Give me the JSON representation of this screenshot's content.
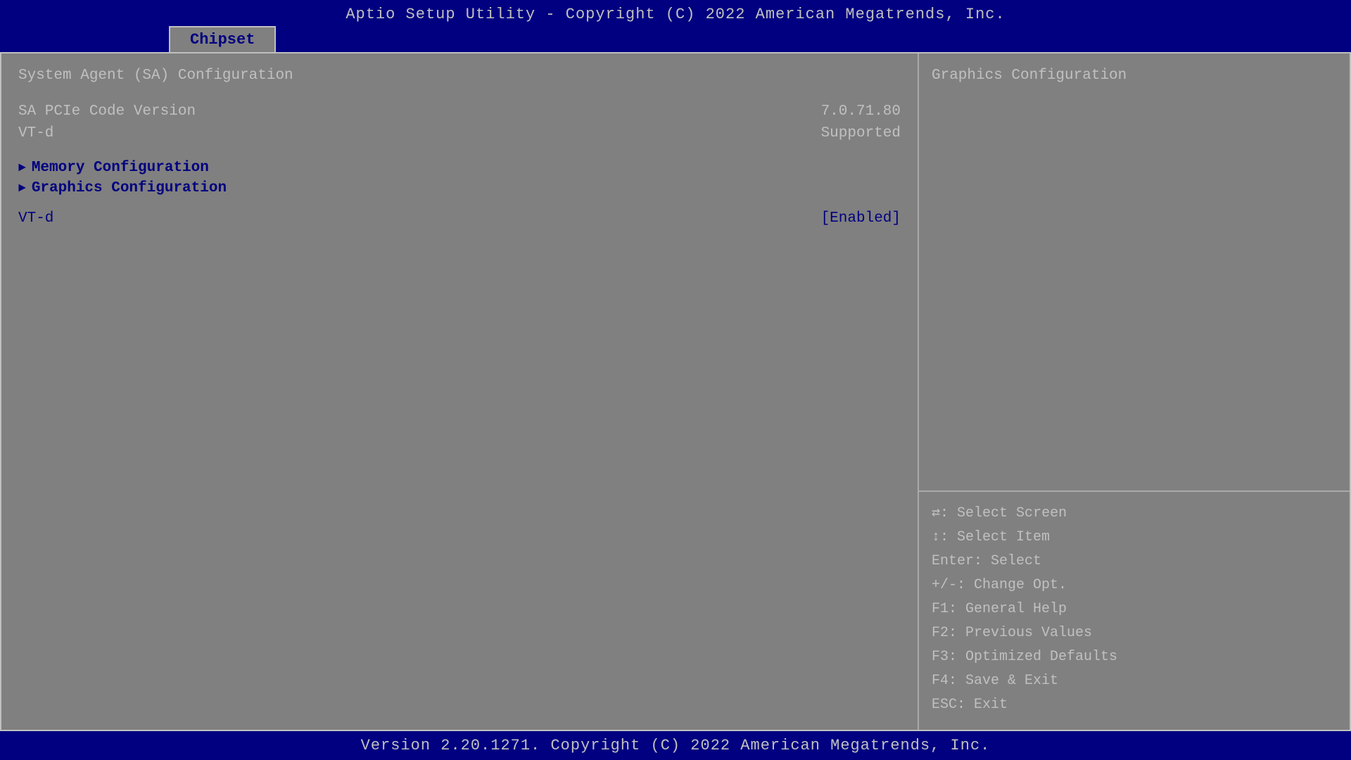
{
  "header": {
    "title": "Aptio Setup Utility - Copyright (C) 2022 American Megatrends, Inc."
  },
  "tab": {
    "label": "Chipset"
  },
  "left": {
    "section_title": "System Agent (SA) Configuration",
    "info_rows": [
      {
        "label": "SA PCIe Code Version",
        "value": "7.0.71.80"
      },
      {
        "label": "VT-d",
        "value": "Supported"
      }
    ],
    "menu_items": [
      {
        "label": "Memory Configuration"
      },
      {
        "label": "Graphics Configuration"
      }
    ],
    "settings": [
      {
        "label": "VT-d",
        "value": "[Enabled]"
      }
    ]
  },
  "right": {
    "title": "Graphics Configuration",
    "help_lines": [
      {
        "key": "↔:",
        "desc": "Select Screen"
      },
      {
        "key": "↑↓:",
        "desc": "Select Item"
      },
      {
        "key": "Enter:",
        "desc": "Select"
      },
      {
        "key": "+/-:",
        "desc": "Change Opt."
      },
      {
        "key": "F1:",
        "desc": "General Help"
      },
      {
        "key": "F2:",
        "desc": "Previous Values"
      },
      {
        "key": "F3:",
        "desc": "Optimized Defaults"
      },
      {
        "key": "F4:",
        "desc": "Save & Exit"
      },
      {
        "key": "ESC:",
        "desc": "Exit"
      }
    ]
  },
  "footer": {
    "text": "Version 2.20.1271. Copyright (C) 2022 American Megatrends, Inc."
  }
}
